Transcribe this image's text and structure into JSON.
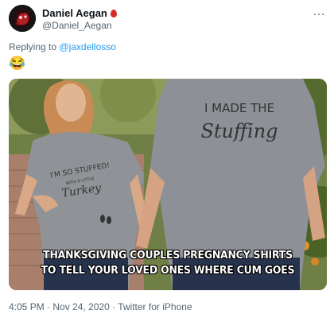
{
  "author": {
    "name": "Daniel Aegan",
    "handle": "@Daniel_Aegan"
  },
  "more_icon": "…",
  "reply": {
    "prefix": "Replying to",
    "to": "@jaxdellosso"
  },
  "emoji": "😂",
  "photo": {
    "shirt_left_line1": "I'M SO STUFFED!",
    "shirt_left_line2": "WITH A LITTLE",
    "shirt_left_line3": "Turkey",
    "shirt_right_line1": "I MADE THE",
    "shirt_right_line2": "Stuffing",
    "caption_line1": "THANKSGIVING COUPLES PREGNANCY SHIRTS",
    "caption_line2": "TO TELL YOUR LOVED ONES WHERE CUM GOES"
  },
  "timestamp": {
    "time": "4:05 PM",
    "separator1": " · ",
    "date": "Nov 24, 2020",
    "separator2": " · ",
    "source": "Twitter for iPhone"
  }
}
